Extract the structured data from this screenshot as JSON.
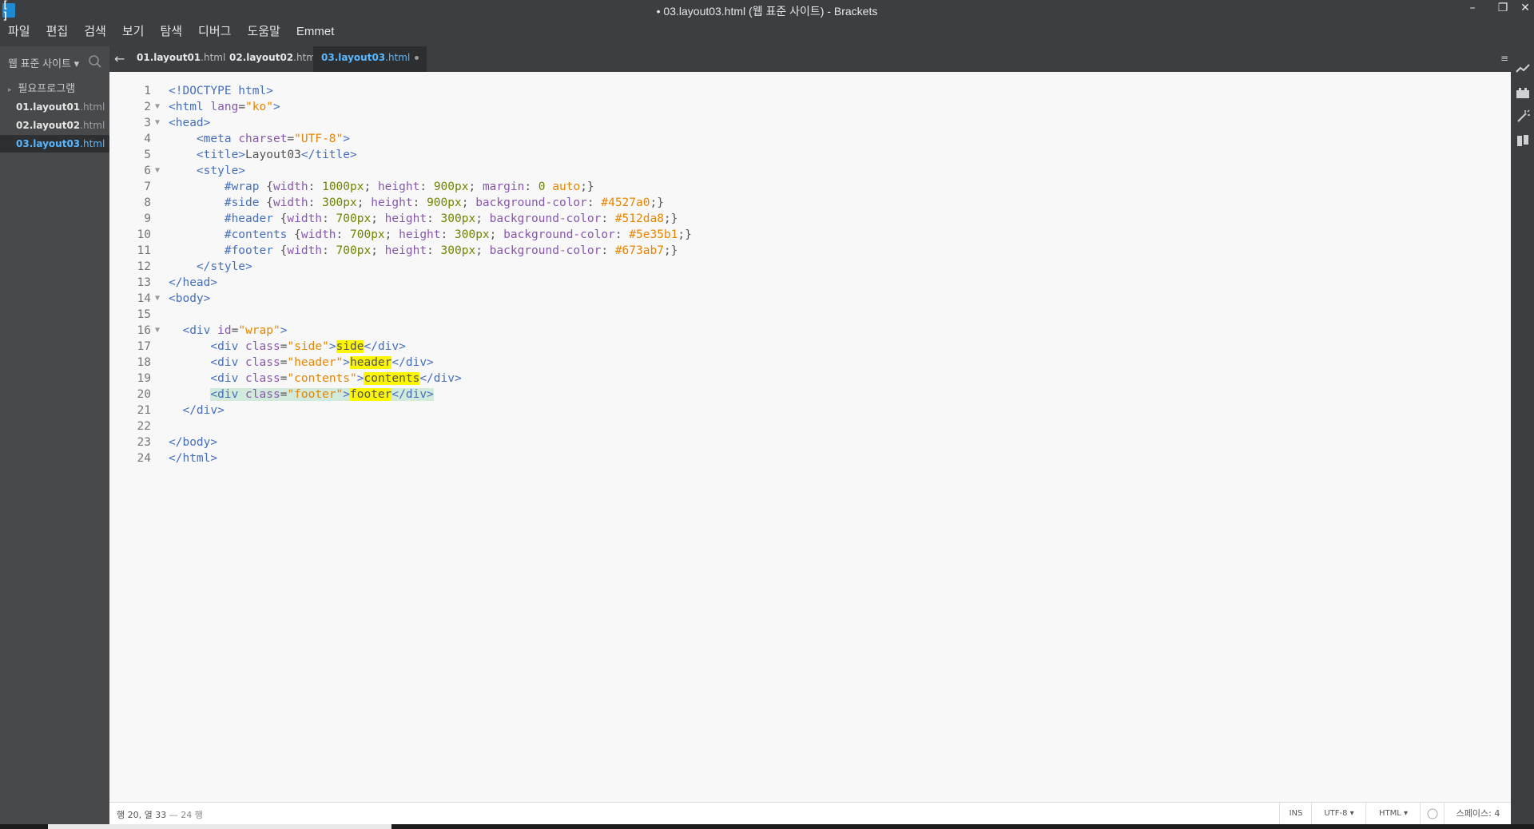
{
  "window": {
    "title": "• 03.layout03.html (웹 표준 사이트) - Brackets",
    "app_icon": "brackets-logo",
    "minimize": "–",
    "restore": "❐",
    "close": "✕"
  },
  "menu": [
    "파일",
    "편집",
    "검색",
    "보기",
    "탐색",
    "디버그",
    "도움말",
    "Emmet"
  ],
  "sidebar": {
    "project": "웹 표준 사이트 ▾",
    "search_icon": "search-icon",
    "folder": "필요프로그램",
    "files": [
      {
        "base": "01.layout01",
        "ext": ".html",
        "selected": false
      },
      {
        "base": "02.layout02",
        "ext": ".html",
        "selected": false
      },
      {
        "base": "03.layout03",
        "ext": ".html",
        "selected": true
      }
    ]
  },
  "tabs": [
    {
      "base": "01.layout01",
      "ext": ".html",
      "active": false
    },
    {
      "base": "02.layout02",
      "ext": ".html",
      "active": false
    },
    {
      "base": "03.layout03",
      "ext": ".html",
      "active": true,
      "dirty": true
    }
  ],
  "editor": {
    "line_numbers": [
      "1",
      "2",
      "3",
      "4",
      "5",
      "6",
      "7",
      "8",
      "9",
      "10",
      "11",
      "12",
      "13",
      "14",
      "15",
      "16",
      "17",
      "18",
      "19",
      "20",
      "21",
      "22",
      "23",
      "24"
    ],
    "fold_lines": [
      2,
      3,
      6,
      14,
      16
    ],
    "code": {
      "l1": "<!DOCTYPE html>",
      "l5_title": "Layout03",
      "css_wrap": "#wrap {width: 1000px; height: 900px; margin: 0 auto;}",
      "css_side": "#side {width: 300px; height: 900px; background-color: #4527a0;}",
      "css_header": "#header {width: 700px; height: 300px; background-color: #512da8;}",
      "css_contents": "#contents {width: 700px; height: 300px; background-color: #5e35b1;}",
      "css_footer": "#footer {width: 700px; height: 300px; background-color: #673ab7;}",
      "div_side_text": "side",
      "div_header_text": "header",
      "div_contents_text": "contents",
      "div_footer_text": "footer"
    }
  },
  "status": {
    "position": "행 20, 열 33",
    "line_count": " — 24 행",
    "mode": "INS",
    "encoding": "UTF-8 ▾",
    "language": "HTML ▾",
    "spaces": "스페이스: 4"
  },
  "colors": {
    "tag": "#446fbd",
    "attribute": "#8757ad",
    "string": "#e88501",
    "highlight": "#fcf600",
    "selected_blue": "#5ab7ff"
  }
}
